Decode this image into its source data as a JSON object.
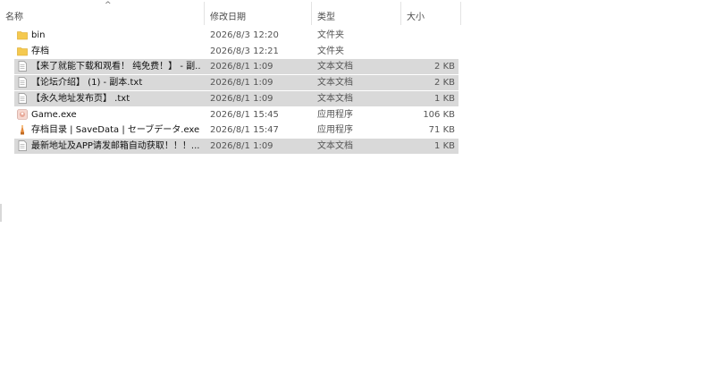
{
  "columns": {
    "name": "名称",
    "modified": "修改日期",
    "type": "类型",
    "size": "大小"
  },
  "files": [
    {
      "name": "bin",
      "modified": "2026/8/3 12:20",
      "type": "文件夹",
      "size": "",
      "icon": "folder-icon",
      "selected": false
    },
    {
      "name": "存档",
      "modified": "2026/8/3 12:21",
      "type": "文件夹",
      "size": "",
      "icon": "folder-icon",
      "selected": false
    },
    {
      "name": "【来了就能下载和观看！ 纯免费！】 - 副...",
      "modified": "2026/8/1 1:09",
      "type": "文本文档",
      "size": "2 KB",
      "icon": "text-file-icon",
      "selected": true
    },
    {
      "name": "【论坛介绍】 (1) - 副本.txt",
      "modified": "2026/8/1 1:09",
      "type": "文本文档",
      "size": "2 KB",
      "icon": "text-file-icon",
      "selected": true
    },
    {
      "name": "【永久地址发布页】 .txt",
      "modified": "2026/8/1 1:09",
      "type": "文本文档",
      "size": "1 KB",
      "icon": "text-file-icon",
      "selected": true
    },
    {
      "name": "Game.exe",
      "modified": "2026/8/1 15:45",
      "type": "应用程序",
      "size": "106 KB",
      "icon": "game-app-icon",
      "selected": false
    },
    {
      "name": "存档目录 | SaveData | セーブデータ.exe",
      "modified": "2026/8/1 15:47",
      "type": "应用程序",
      "size": "71 KB",
      "icon": "save-app-icon",
      "selected": false
    },
    {
      "name": "最新地址及APP请发邮箱自动获取！！！...",
      "modified": "2026/8/1 1:09",
      "type": "文本文档",
      "size": "1 KB",
      "icon": "text-file-icon",
      "selected": true
    }
  ]
}
